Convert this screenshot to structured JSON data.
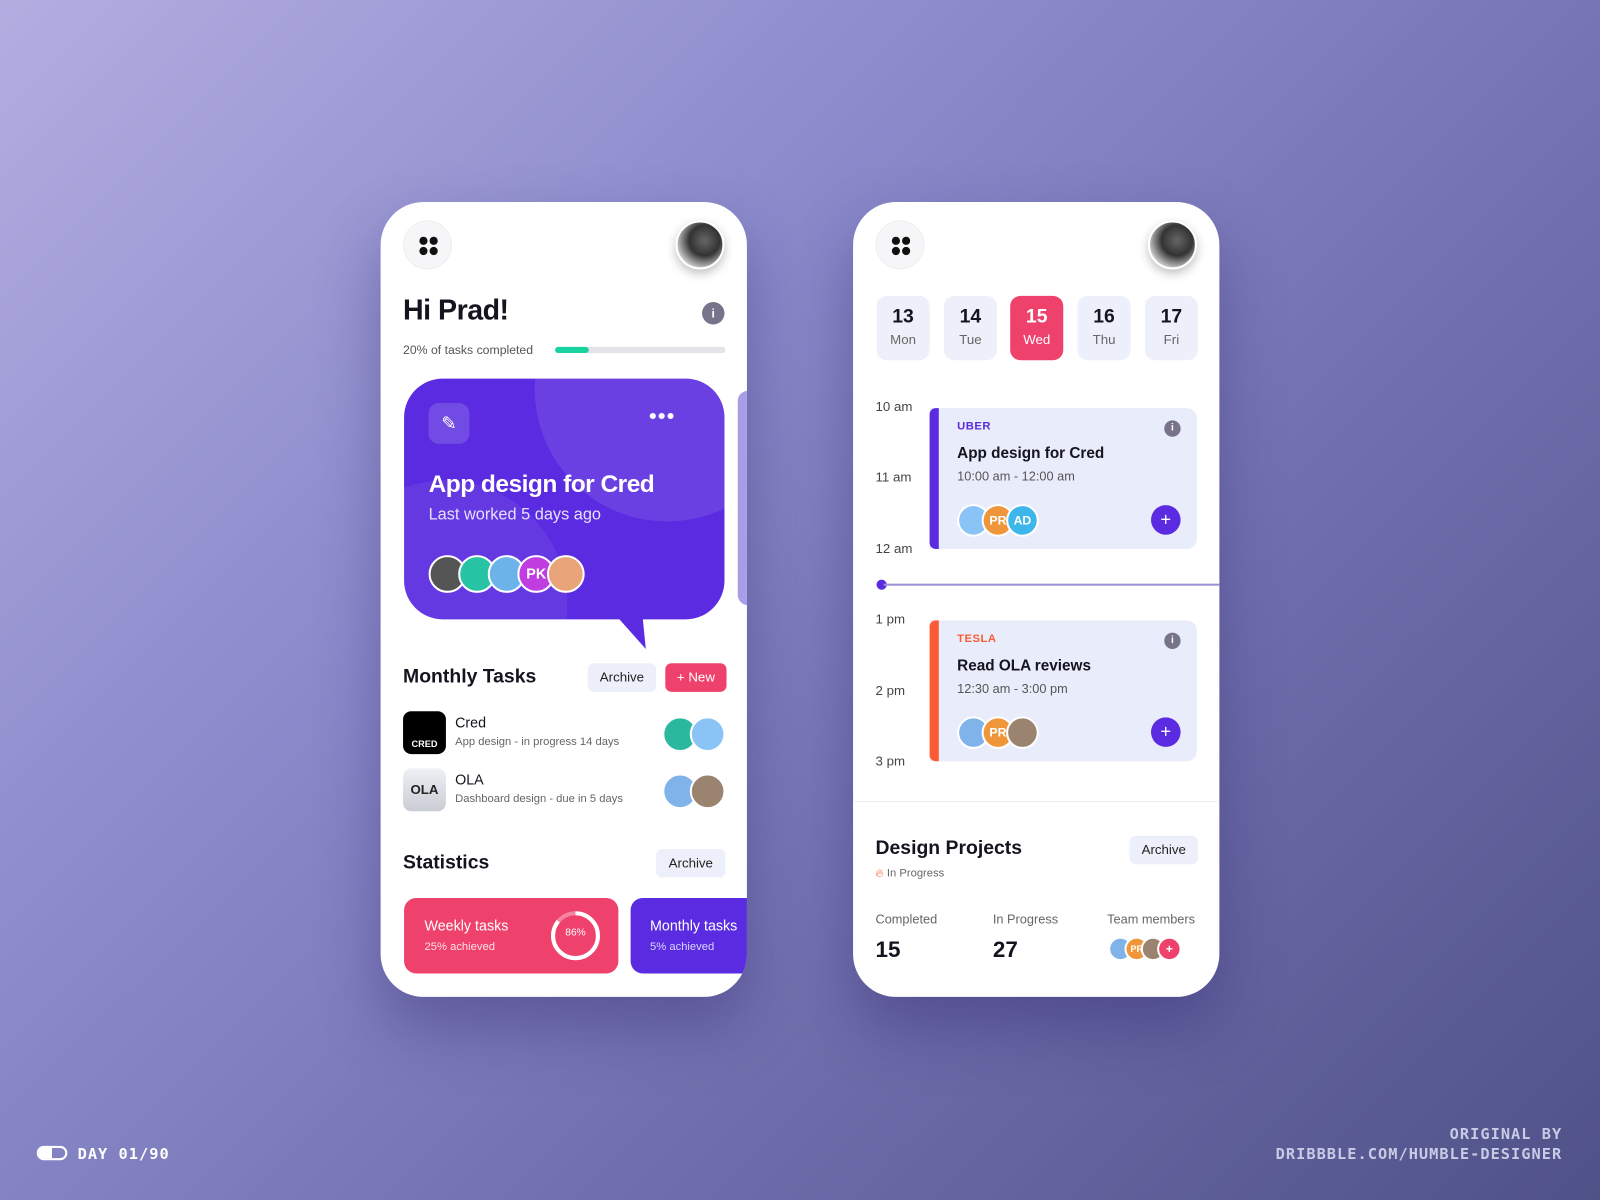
{
  "screen1": {
    "greeting": "Hi Prad!",
    "progress_label": "20% of tasks completed",
    "progress": 0.2,
    "hero": {
      "title": "App design for Cred",
      "subtitle": "Last worked 5 days ago",
      "members": [
        "PK"
      ]
    },
    "monthly": {
      "title": "Monthly Tasks",
      "archive_label": "Archive",
      "new_label": "+ New",
      "items": [
        {
          "logo": "CRED",
          "name": "Cred",
          "detail": "App design - in progress 14 days"
        },
        {
          "logo": "OLA",
          "name": "OLA",
          "detail": "Dashboard design - due in 5 days"
        }
      ]
    },
    "statistics": {
      "title": "Statistics",
      "archive_label": "Archive",
      "cards": [
        {
          "title": "Weekly tasks",
          "sub": "25% achieved",
          "ring": "86%",
          "ring_value": 0.86,
          "color": "#ee426d"
        },
        {
          "title": "Monthly tasks",
          "sub": "5% achieved",
          "color": "#5a2be0"
        }
      ]
    }
  },
  "screen2": {
    "days": [
      {
        "num": "13",
        "wd": "Mon"
      },
      {
        "num": "14",
        "wd": "Tue"
      },
      {
        "num": "15",
        "wd": "Wed",
        "selected": true
      },
      {
        "num": "16",
        "wd": "Thu"
      },
      {
        "num": "17",
        "wd": "Fri"
      }
    ],
    "hours": [
      "10 am",
      "11 am",
      "12 am",
      "1 pm",
      "2 pm",
      "3 pm"
    ],
    "events": [
      {
        "company": "UBER",
        "title": "App design for Cred",
        "time": "10:00 am - 12:00 am",
        "members": [
          "PR",
          "AD"
        ],
        "color": "#5a2be0"
      },
      {
        "company": "TESLA",
        "title": "Read OLA reviews",
        "time": "12:30 am - 3:00 pm",
        "members": [
          "PR"
        ],
        "color": "#fb5b34"
      }
    ],
    "projects": {
      "title": "Design Projects",
      "status": "In Progress",
      "archive_label": "Archive",
      "completed_label": "Completed",
      "completed": "15",
      "inprogress_label": "In Progress",
      "inprogress": "27",
      "team_label": "Team members",
      "team": [
        "PR"
      ],
      "add": "+"
    }
  },
  "footer": {
    "day": "DAY 01/90",
    "credit1": "ORIGINAL BY",
    "credit2": "DRIBBBLE.COM/HUMBLE-DESIGNER"
  },
  "colors": {
    "primary": "#5a2be0",
    "accent": "#ee426d",
    "progress": "#17d3a0",
    "tesla": "#fb5b34"
  }
}
